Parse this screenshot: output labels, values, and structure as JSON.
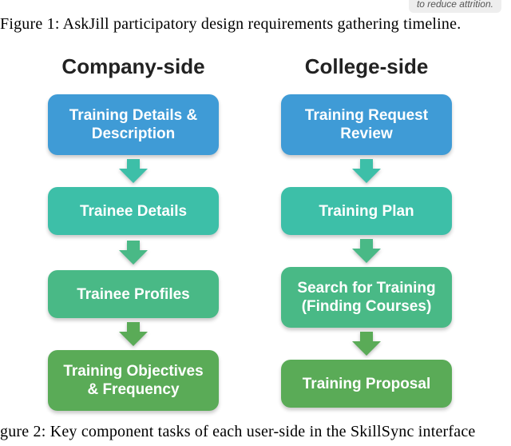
{
  "top_pill_text": "to reduce attrition.",
  "figure1_caption": "Figure 1: AskJill participatory design requirements gathering timeline.",
  "figure2_caption": "gure 2: Key component tasks of each user-side in the SkillSync interface",
  "columns": {
    "company": {
      "header": "Company-side",
      "boxes": {
        "b1": "Training Details & Description",
        "b2": "Trainee Details",
        "b3": "Trainee Profiles",
        "b4": "Training Objectives & Frequency"
      }
    },
    "college": {
      "header": "College-side",
      "boxes": {
        "b1": "Training Request Review",
        "b2": "Training Plan",
        "b3": "Search for Training (Finding Courses)",
        "b4": "Training Proposal"
      }
    }
  },
  "chart_data": {
    "type": "flow",
    "title": "Key component tasks of each user-side in the SkillSync interface",
    "columns": [
      {
        "name": "Company-side",
        "steps": [
          "Training Details & Description",
          "Trainee Details",
          "Trainee Profiles",
          "Training Objectives & Frequency"
        ]
      },
      {
        "name": "College-side",
        "steps": [
          "Training Request Review",
          "Training Plan",
          "Search for Training (Finding Courses)",
          "Training Proposal"
        ]
      }
    ],
    "step_colors": [
      "#3f9bd6",
      "#3dbfa8",
      "#49b986",
      "#5aab57"
    ]
  }
}
